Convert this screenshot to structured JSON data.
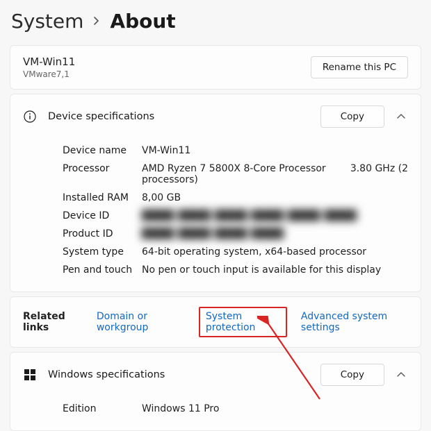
{
  "breadcrumb": {
    "parent": "System",
    "current": "About"
  },
  "pc": {
    "name": "VM-Win11",
    "subtitle": "VMware7,1",
    "rename_label": "Rename this PC"
  },
  "device_specs": {
    "heading": "Device specifications",
    "copy_label": "Copy",
    "rows": {
      "device_name": {
        "label": "Device name",
        "value": "VM-Win11"
      },
      "processor": {
        "label": "Processor",
        "value": "AMD Ryzen 7 5800X 8-Core Processor processors)",
        "extra": "3.80 GHz  (2"
      },
      "ram": {
        "label": "Installed RAM",
        "value": "8,00 GB"
      },
      "device_id": {
        "label": "Device ID",
        "value": "████ ████ ████ ████ ████ ████"
      },
      "product_id": {
        "label": "Product ID",
        "value": "████ ████ ████ ████"
      },
      "system_type": {
        "label": "System type",
        "value": "64-bit operating system, x64-based processor"
      },
      "pen_touch": {
        "label": "Pen and touch",
        "value": "No pen or touch input is available for this display"
      }
    }
  },
  "related": {
    "label": "Related links",
    "domain": "Domain or workgroup",
    "protection": "System protection",
    "advanced": "Advanced system settings"
  },
  "win_specs": {
    "heading": "Windows specifications",
    "copy_label": "Copy",
    "edition": {
      "label": "Edition",
      "value": "Windows 11 Pro"
    }
  }
}
